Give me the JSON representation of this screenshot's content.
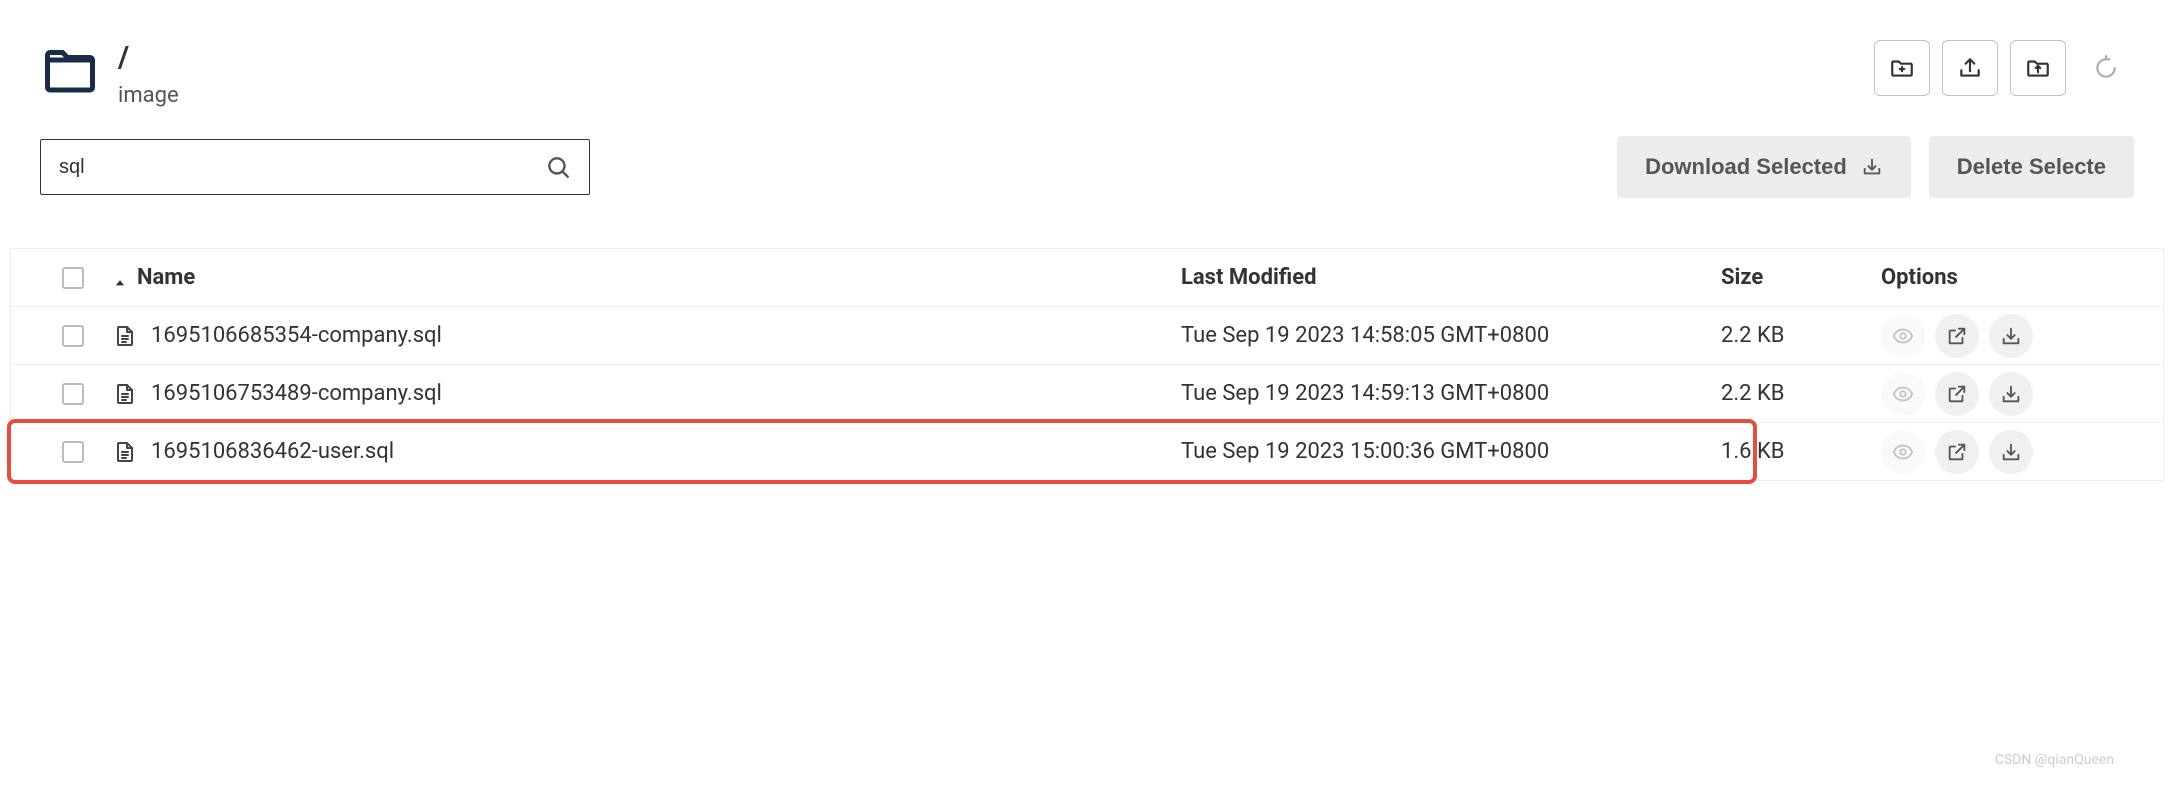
{
  "breadcrumb": {
    "root": "/",
    "sub": "image"
  },
  "search": {
    "value": "sql"
  },
  "bulk": {
    "download": "Download Selected",
    "delete": "Delete Selecte"
  },
  "table": {
    "headers": {
      "name": "Name",
      "modified": "Last Modified",
      "size": "Size",
      "options": "Options"
    },
    "rows": [
      {
        "name": "1695106685354-company.sql",
        "modified": "Tue Sep 19 2023 14:58:05 GMT+0800",
        "size": "2.2 KB",
        "highlight": false
      },
      {
        "name": "1695106753489-company.sql",
        "modified": "Tue Sep 19 2023 14:59:13 GMT+0800",
        "size": "2.2 KB",
        "highlight": false
      },
      {
        "name": "1695106836462-user.sql",
        "modified": "Tue Sep 19 2023 15:00:36 GMT+0800",
        "size": "1.6 KB",
        "highlight": true
      }
    ]
  },
  "watermark": "CSDN @qianQueen"
}
